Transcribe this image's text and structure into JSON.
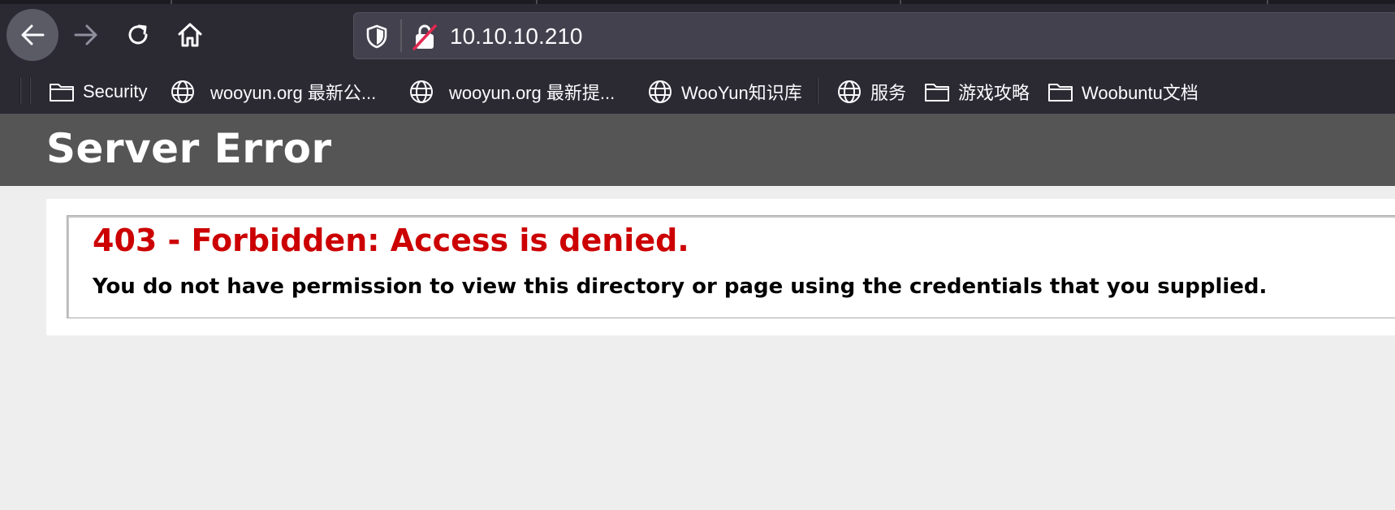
{
  "browser": {
    "url": "10.10.10.210",
    "bookmarks": [
      {
        "label": "Security",
        "icon": "folder-icon"
      },
      {
        "label": "wooyun.org 最新公...",
        "icon": "globe-icon"
      },
      {
        "label": "wooyun.org 最新提...",
        "icon": "globe-icon"
      },
      {
        "label": "WooYun知识库",
        "icon": "globe-icon"
      },
      {
        "label": "服务",
        "icon": "globe-icon"
      },
      {
        "label": "游戏攻略",
        "icon": "folder-icon"
      },
      {
        "label": "Woobuntu文档",
        "icon": "folder-icon"
      }
    ]
  },
  "page": {
    "header_title": "Server Error",
    "error_title": "403 - Forbidden: Access is denied.",
    "error_message": "You do not have permission to view this directory or page using the credentials that you supplied."
  },
  "colors": {
    "chrome_bg": "#2b2a33",
    "urlbar_bg": "#42414d",
    "header_bg": "#555555",
    "error_red": "#cc0000"
  }
}
